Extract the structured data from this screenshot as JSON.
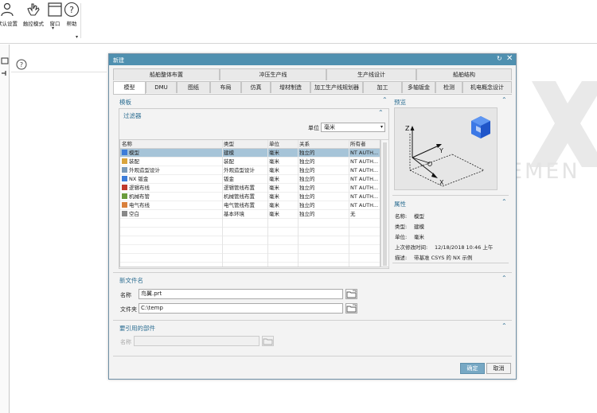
{
  "ribbon": {
    "default_settings_label": "默认设置",
    "touch_mode_label": "触控模式",
    "window_label": "窗口",
    "help_label": "帮助"
  },
  "dialog": {
    "title": "新建",
    "tabs_row1": [
      "船舶整体布置",
      "冲压生产线",
      "生产线设计",
      "船舶结构"
    ],
    "tabs_row2": [
      "模型",
      "DMU",
      "图纸",
      "布局",
      "仿真",
      "增材制造",
      "加工生产线规划器",
      "加工",
      "多轴钣金",
      "检测",
      "机电概念设计"
    ],
    "active_tab": "模型",
    "template_section": "模板",
    "filter_section": "过滤器",
    "unit_label": "单位",
    "unit_value": "毫米",
    "table": {
      "columns": [
        "名称",
        "类型",
        "单位",
        "关系",
        "所有者"
      ],
      "rows": [
        {
          "name": "模型",
          "type": "建模",
          "unit": "毫米",
          "rel": "独立的",
          "owner": "NT AUTH...",
          "icon": "model-icon"
        },
        {
          "name": "装配",
          "type": "装配",
          "unit": "毫米",
          "rel": "独立的",
          "owner": "NT AUTH...",
          "icon": "assembly-icon"
        },
        {
          "name": "外观造型设计",
          "type": "外观造型设计",
          "unit": "毫米",
          "rel": "独立的",
          "owner": "NT AUTH...",
          "icon": "shape-studio-icon"
        },
        {
          "name": "NX 钣金",
          "type": "钣金",
          "unit": "毫米",
          "rel": "独立的",
          "owner": "NT AUTH...",
          "icon": "sheet-metal-icon"
        },
        {
          "name": "逻辑布线",
          "type": "逻辑管线布置",
          "unit": "毫米",
          "rel": "独立的",
          "owner": "NT AUTH...",
          "icon": "logical-routing-icon"
        },
        {
          "name": "机械布管",
          "type": "机械管线布置",
          "unit": "毫米",
          "rel": "独立的",
          "owner": "NT AUTH...",
          "icon": "mechanical-routing-icon"
        },
        {
          "name": "电气布线",
          "type": "电气管线布置",
          "unit": "毫米",
          "rel": "独立的",
          "owner": "NT AUTH...",
          "icon": "electrical-routing-icon"
        },
        {
          "name": "空白",
          "type": "基本环境",
          "unit": "毫米",
          "rel": "独立的",
          "owner": "无",
          "icon": "blank-icon"
        }
      ],
      "selected_index": 0
    },
    "preview_section": "预览",
    "properties_section": "属性",
    "properties": {
      "name_label": "名称:",
      "name_value": "模型",
      "type_label": "类型:",
      "type_value": "建模",
      "unit_label": "单位:",
      "unit_value": "毫米",
      "modified_label": "上次修改时间:",
      "modified_value": "12/18/2018 10:46 上午",
      "desc_label": "描述:",
      "desc_value": "带基准 CSYS 的 NX 示例"
    },
    "new_file_section": "新文件名",
    "name_field_label": "名称",
    "name_field_value": "鸟翼.prt",
    "folder_field_label": "文件夹",
    "folder_field_value": "C:\\temp",
    "ref_part_section": "要引用的部件",
    "ref_name_label": "名称",
    "ok_label": "确定",
    "cancel_label": "取消"
  },
  "preview_axes": {
    "z": "Z",
    "y": "Y",
    "x": "X"
  },
  "watermark_text": "EMEN",
  "colors": {
    "title_bar": "#4f90b0",
    "section_heading": "#2e6f93",
    "selected_row": "#a6c4d8",
    "ok_button": "#77a8c4"
  }
}
